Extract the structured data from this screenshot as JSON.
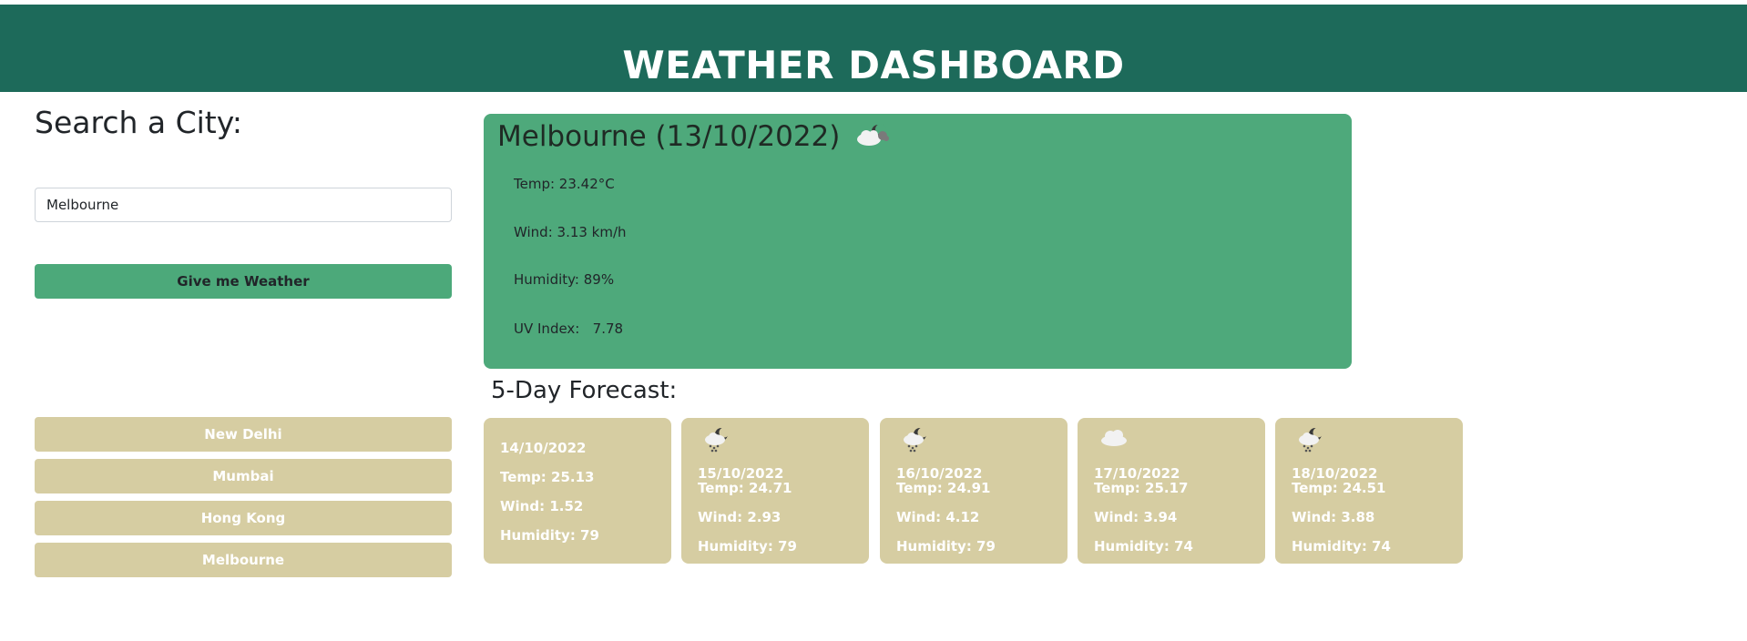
{
  "header": {
    "title": "WEATHER DASHBOARD"
  },
  "search": {
    "heading": "Search a City:",
    "input_value": "Melbourne",
    "button_label": "Give me Weather"
  },
  "history": [
    "New Delhi",
    "Mumbai",
    "Hong Kong",
    "Melbourne"
  ],
  "current": {
    "title": "Melbourne (13/10/2022)",
    "icon": "cloudy-night-icon",
    "temp": "Temp: 23.42°C",
    "wind": "Wind: 3.13 km/h",
    "humidity": "Humidity: 89%",
    "uv": "UV Index:   7.78"
  },
  "forecast": {
    "heading": "5-Day Forecast:",
    "cards": [
      {
        "date": "14/10/2022",
        "temp": "Temp: 25.13",
        "wind": "Wind: 1.52",
        "humidity": "Humidity: 79",
        "icon": ""
      },
      {
        "date": "15/10/2022",
        "temp": "Temp: 24.71",
        "wind": "Wind: 2.93",
        "humidity": "Humidity: 79",
        "icon": "rain-night-icon"
      },
      {
        "date": "16/10/2022",
        "temp": "Temp: 24.91",
        "wind": "Wind: 4.12",
        "humidity": "Humidity: 79",
        "icon": "rain-night-icon"
      },
      {
        "date": "17/10/2022",
        "temp": "Temp: 25.17",
        "wind": "Wind: 3.94",
        "humidity": "Humidity: 74",
        "icon": "cloud-icon"
      },
      {
        "date": "18/10/2022",
        "temp": "Temp: 24.51",
        "wind": "Wind: 3.88",
        "humidity": "Humidity: 74",
        "icon": "rain-night-icon"
      }
    ]
  },
  "colors": {
    "header_bg": "#1d6a5a",
    "accent_green": "#4ea97b",
    "card_tan": "#d6cda2"
  }
}
